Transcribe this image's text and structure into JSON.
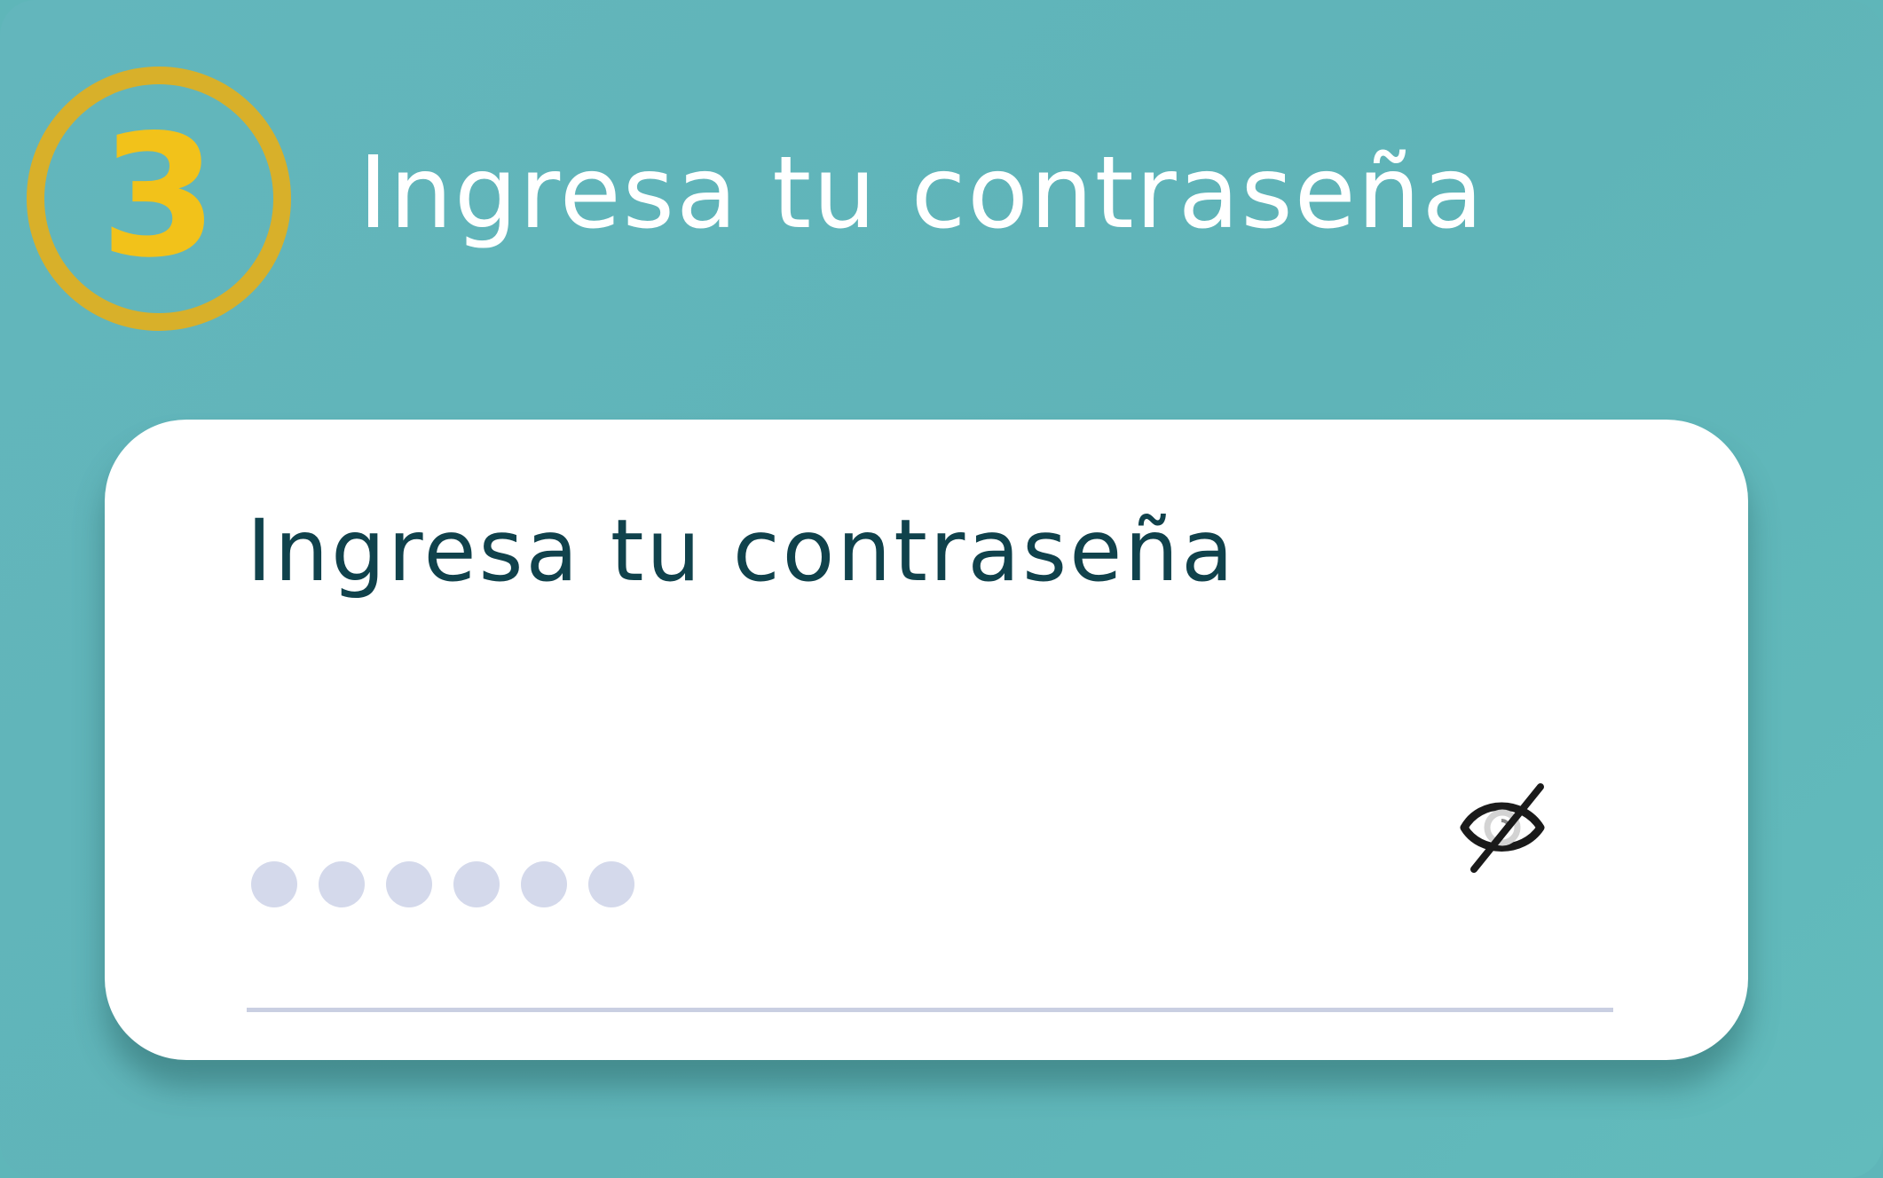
{
  "step": {
    "number": "3",
    "title": "Ingresa tu contraseña"
  },
  "password_field": {
    "label": "Ingresa tu contraseña",
    "masked_length": 6,
    "visibility_icon": "eye-off-icon"
  },
  "colors": {
    "background": "#5fb6b9",
    "badge_ring": "#d8b02a",
    "badge_number": "#f2c21a",
    "label_text": "#10424c",
    "mask_dot": "#d4d9eb",
    "underline": "#c9cfe2"
  }
}
